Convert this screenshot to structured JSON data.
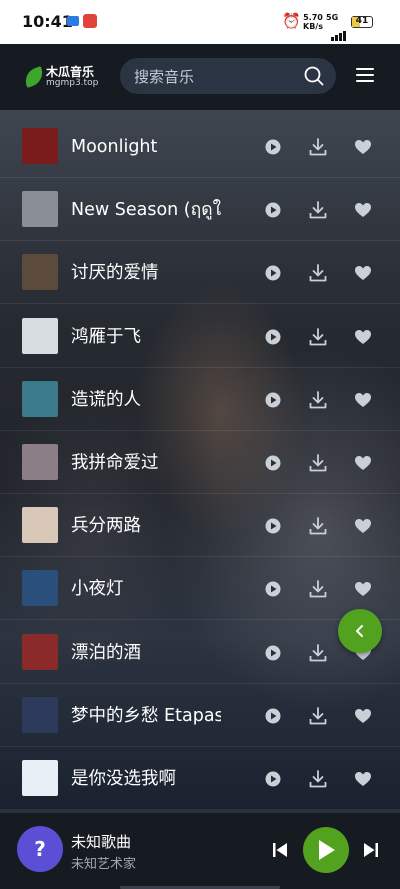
{
  "status_bar": {
    "time": "10:41",
    "net_speed_value": "5.70",
    "net_speed_unit": "KB/s",
    "signal_label": "5G",
    "battery": "41"
  },
  "header": {
    "brand": "木瓜音乐",
    "brand_sub": "mgmp3.top",
    "search_placeholder": "搜索音乐"
  },
  "songs": [
    {
      "title": "Moonlight",
      "thumb": "#7a1c1c"
    },
    {
      "title": "New Season (ฤดูใ",
      "thumb": "#8a8f96"
    },
    {
      "title": "讨厌的爱情",
      "thumb": "#5c4a3d"
    },
    {
      "title": "鸿雁于飞",
      "thumb": "#d8dde2"
    },
    {
      "title": "造谎的人",
      "thumb": "#3a7a8a"
    },
    {
      "title": "我拼命爱过",
      "thumb": "#8c7e86"
    },
    {
      "title": "兵分两路",
      "thumb": "#d9c7b8"
    },
    {
      "title": "小夜灯",
      "thumb": "#2a4f7a"
    },
    {
      "title": "漂泊的酒",
      "thumb": "#8a2a2a"
    },
    {
      "title": "梦中的乡愁 Etapas",
      "thumb": "#2d3a5c"
    },
    {
      "title": "是你没选我啊",
      "thumb": "#e8eef5"
    }
  ],
  "player": {
    "avatar_text": "?",
    "title": "未知歌曲",
    "artist": "未知艺术家"
  },
  "colors": {
    "accent_green": "#52a11f",
    "header_bg": "#161b22",
    "search_bg": "#2a3442",
    "avatar_bg": "#5b4fd6"
  },
  "icons": [
    "search-icon",
    "menu-icon",
    "play-icon",
    "download-icon",
    "heart-icon",
    "chevron-left-icon",
    "skip-previous-icon",
    "skip-next-icon"
  ]
}
